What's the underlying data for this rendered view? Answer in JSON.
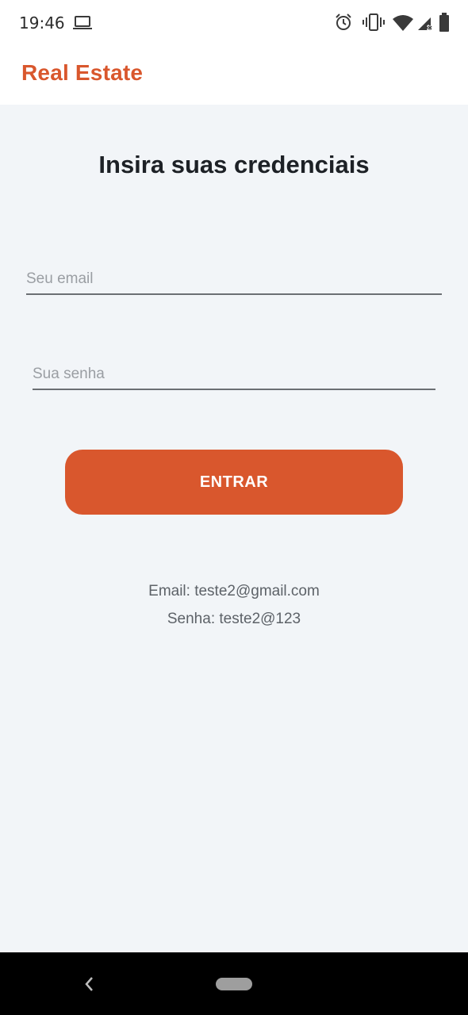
{
  "status_bar": {
    "time": "19:46",
    "icons": [
      "laptop-icon",
      "alarm-icon",
      "vibrate-icon",
      "wifi-icon",
      "signal-icon",
      "battery-icon"
    ]
  },
  "app_bar": {
    "title": "Real Estate",
    "accent_color": "#d9572d"
  },
  "login": {
    "heading": "Insira suas credenciais",
    "email_placeholder": "Seu email",
    "email_value": "",
    "password_placeholder": "Sua senha",
    "password_value": "",
    "submit_label": "ENTRAR"
  },
  "hints": {
    "email": "Email: teste2@gmail.com",
    "password": "Senha: teste2@123"
  },
  "nav_bar": {
    "icons": [
      "back-icon",
      "home-pill"
    ]
  }
}
